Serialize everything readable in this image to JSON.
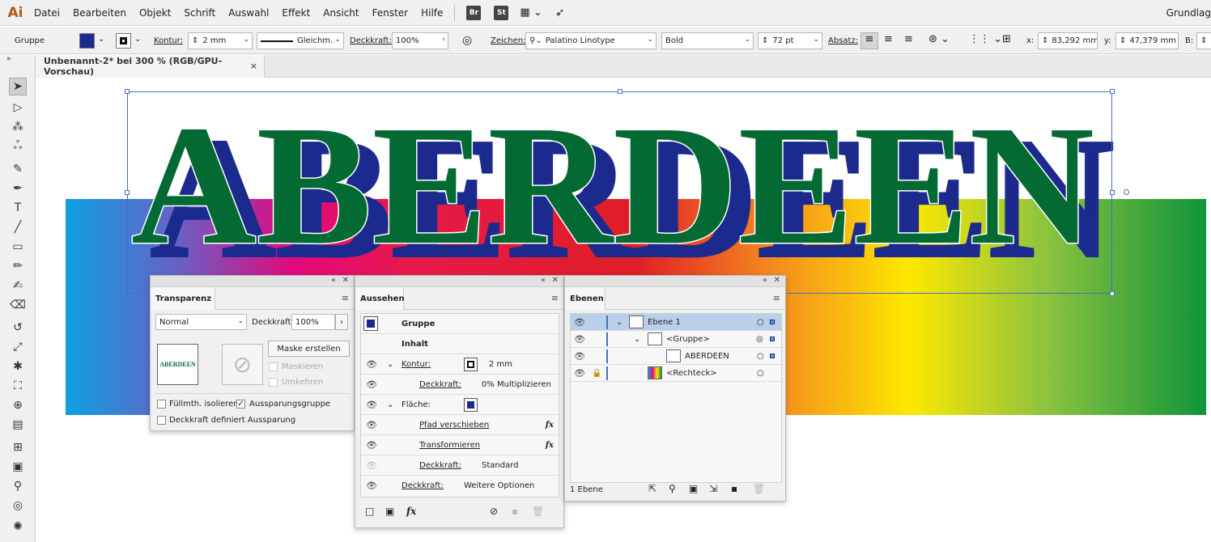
{
  "app": {
    "logo": "Ai",
    "workspace": "Grundlag"
  },
  "menu": [
    "Datei",
    "Bearbeiten",
    "Objekt",
    "Schrift",
    "Auswahl",
    "Effekt",
    "Ansicht",
    "Fenster",
    "Hilfe"
  ],
  "menu_buttons": {
    "br": "Br",
    "st": "St"
  },
  "control": {
    "selection": "Gruppe",
    "fill_color": "#1b2a8c",
    "kontur_label": "Kontur:",
    "kontur_value": "2 mm",
    "stroke_style": "Gleichm.",
    "deckkraft_label": "Deckkraft:",
    "deckkraft_value": "100%",
    "zeichen_label": "Zeichen:",
    "font": "Palatino Linotype",
    "font_style": "Bold",
    "font_size": "72 pt",
    "absatz_label": "Absatz:",
    "x_label": "x:",
    "x_value": "83,292 mm",
    "y_label": "y:",
    "y_value": "47,379 mm",
    "b_label": "B:"
  },
  "document_tab": {
    "title": "Unbenannt-2* bei 300 % (RGB/GPU-Vorschau)",
    "close": "×"
  },
  "artwork": {
    "text": "ABERDEEN",
    "fill": "#036a34",
    "shadow": "#1b2a8c"
  },
  "transparency": {
    "title": "Transparenz",
    "blend_mode": "Normal",
    "opacity_label": "Deckkraft:",
    "opacity_value": "100%",
    "thumb_text": "ABERDEEN",
    "mask_button": "Maske erstellen",
    "clip_label": "Maskieren",
    "invert_label": "Umkehren",
    "isolate_label": "Füllmth. isolieren",
    "knockout_label": "Aussparungsgruppe",
    "opacity_knockout_label": "Deckkraft definiert Aussparung"
  },
  "appearance": {
    "title": "Aussehen",
    "object": "Gruppe",
    "contents": "Inhalt",
    "kontur_label": "Kontur:",
    "kontur_value": "2 mm",
    "deckkraft1_label": "Deckkraft:",
    "deckkraft1_value": "0% Multiplizieren",
    "flaeche_label": "Fläche:",
    "effect1": "Pfad verschieben",
    "effect2": "Transformieren",
    "deckkraft2_label": "Deckkraft:",
    "deckkraft2_value": "Standard",
    "deckkraft3_label": "Deckkraft:",
    "deckkraft3_value": "Weitere Optionen",
    "fx": "fx"
  },
  "layers": {
    "title": "Ebenen",
    "items": [
      {
        "name": "Ebene 1"
      },
      {
        "name": "<Gruppe>"
      },
      {
        "name": "ABERDEEN"
      },
      {
        "name": "<Rechteck>"
      }
    ],
    "count": "1 Ebene"
  }
}
